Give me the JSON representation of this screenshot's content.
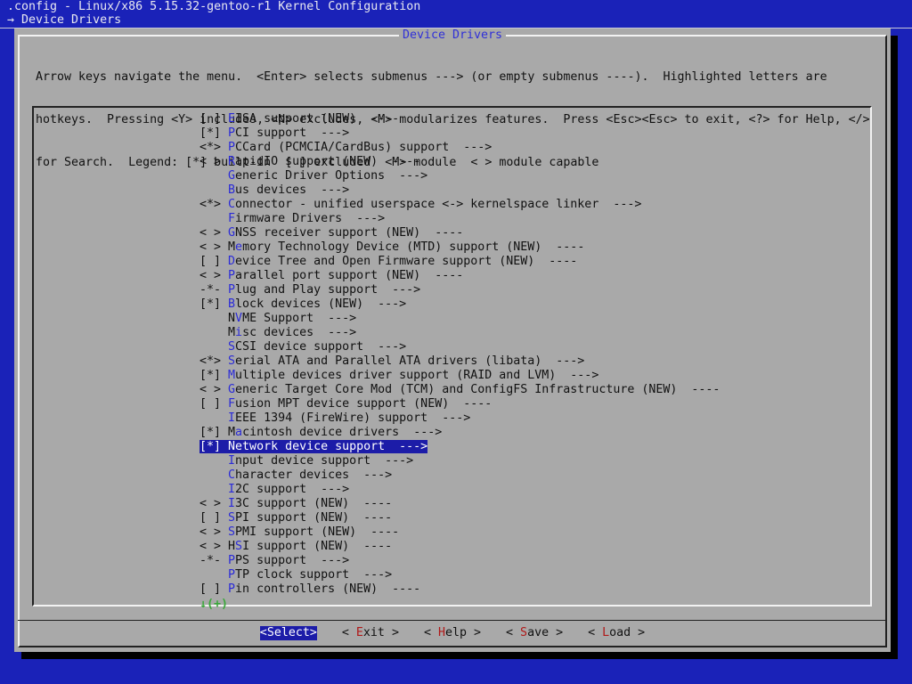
{
  "window": {
    "title": ".config - Linux/x86 5.15.32-gentoo-r1 Kernel Configuration",
    "breadcrumb_arrow": "→",
    "breadcrumb": "Device Drivers"
  },
  "dialog": {
    "title": "Device Drivers",
    "help_lines": [
      "Arrow keys navigate the menu.  <Enter> selects submenus ---> (or empty submenus ----).  Highlighted letters are",
      "hotkeys.  Pressing <Y> includes, <N> excludes, <M> modularizes features.  Press <Esc><Esc> to exit, <?> for Help, </>",
      "for Search.  Legend: [*] built-in  [ ] excluded  <M> module  < > module capable"
    ]
  },
  "menu": {
    "selected_index": 23,
    "items": [
      {
        "prefix": "[ ] ",
        "hotkey": "E",
        "rest": "ISA support (NEW)  ----"
      },
      {
        "prefix": "[*] ",
        "hotkey": "P",
        "rest": "CI support  --->"
      },
      {
        "prefix": "<*> ",
        "hotkey": "P",
        "rest": "CCard (PCMCIA/CardBus) support  --->"
      },
      {
        "prefix": "< > ",
        "hotkey": "R",
        "rest": "apidIO support (NEW)  ----"
      },
      {
        "prefix": "    ",
        "hotkey": "G",
        "rest": "eneric Driver Options  --->"
      },
      {
        "prefix": "    ",
        "hotkey": "B",
        "rest": "us devices  --->"
      },
      {
        "prefix": "<*> ",
        "hotkey": "C",
        "rest": "onnector - unified userspace <-> kernelspace linker  --->"
      },
      {
        "prefix": "    ",
        "hotkey": "F",
        "rest": "irmware Drivers  --->"
      },
      {
        "prefix": "< > ",
        "hotkey": "G",
        "rest": "NSS receiver support (NEW)  ----"
      },
      {
        "prefix": "< > ",
        "pre": "M",
        "hotkey": "e",
        "rest": "mory Technology Device (MTD) support (NEW)  ----"
      },
      {
        "prefix": "[ ] ",
        "hotkey": "D",
        "rest": "evice Tree and Open Firmware support (NEW)  ----"
      },
      {
        "prefix": "< > ",
        "hotkey": "P",
        "rest": "arallel port support (NEW)  ----"
      },
      {
        "prefix": "-*- ",
        "hotkey": "P",
        "rest": "lug and Play support  --->"
      },
      {
        "prefix": "[*] ",
        "hotkey": "B",
        "rest": "lock devices (NEW)  --->"
      },
      {
        "prefix": "    ",
        "pre": "N",
        "hotkey": "V",
        "rest": "ME Support  --->"
      },
      {
        "prefix": "    ",
        "pre": "M",
        "hotkey": "i",
        "rest": "sc devices  --->"
      },
      {
        "prefix": "    ",
        "hotkey": "S",
        "rest": "CSI device support  --->"
      },
      {
        "prefix": "<*> ",
        "hotkey": "S",
        "rest": "erial ATA and Parallel ATA drivers (libata)  --->"
      },
      {
        "prefix": "[*] ",
        "hotkey": "M",
        "rest": "ultiple devices driver support (RAID and LVM)  --->"
      },
      {
        "prefix": "< > ",
        "hotkey": "G",
        "rest": "eneric Target Core Mod (TCM) and ConfigFS Infrastructure (NEW)  ----"
      },
      {
        "prefix": "[ ] ",
        "hotkey": "F",
        "rest": "usion MPT device support (NEW)  ----"
      },
      {
        "prefix": "    ",
        "hotkey": "I",
        "rest": "EEE 1394 (FireWire) support  --->"
      },
      {
        "prefix": "[*] ",
        "pre": "M",
        "hotkey": "a",
        "rest": "cintosh device drivers  --->"
      },
      {
        "prefix": "[*] ",
        "hotkey": "N",
        "rest": "etwork device support  --->"
      },
      {
        "prefix": "    ",
        "hotkey": "I",
        "rest": "nput device support  --->"
      },
      {
        "prefix": "    ",
        "hotkey": "C",
        "rest": "haracter devices  --->"
      },
      {
        "prefix": "    ",
        "hotkey": "I",
        "rest": "2C support  --->"
      },
      {
        "prefix": "< > ",
        "hotkey": "I",
        "rest": "3C support (NEW)  ----"
      },
      {
        "prefix": "[ ] ",
        "hotkey": "S",
        "rest": "PI support (NEW)  ----"
      },
      {
        "prefix": "< > ",
        "hotkey": "S",
        "rest": "PMI support (NEW)  ----"
      },
      {
        "prefix": "< > ",
        "pre": "H",
        "hotkey": "S",
        "rest": "I support (NEW)  ----"
      },
      {
        "prefix": "-*- ",
        "hotkey": "P",
        "rest": "PS support  --->"
      },
      {
        "prefix": "    ",
        "hotkey": "P",
        "rest": "TP clock support  --->"
      },
      {
        "prefix": "[ ] ",
        "hotkey": "P",
        "rest": "in controllers (NEW)  ----"
      }
    ],
    "scroll_indicator": "↓(+)"
  },
  "buttons": [
    {
      "name": "select-button",
      "open": "<",
      "hotkey": "S",
      "rest": "elect",
      "close": ">",
      "active": true
    },
    {
      "name": "exit-button",
      "open": "< ",
      "hotkey": "E",
      "rest": "xit",
      "close": " >",
      "active": false
    },
    {
      "name": "help-button",
      "open": "< ",
      "hotkey": "H",
      "rest": "elp",
      "close": " >",
      "active": false
    },
    {
      "name": "save-button",
      "open": "< ",
      "hotkey": "S",
      "rest": "ave",
      "close": " >",
      "active": false
    },
    {
      "name": "load-button",
      "open": "< ",
      "hotkey": "L",
      "rest": "oad",
      "close": " >",
      "active": false
    }
  ],
  "colors": {
    "background": "#1a22b8",
    "dialog": "#a9a9a9",
    "hotkey": "#2a2ad8",
    "selection": "#1c1ca8",
    "button_hotkey": "#b01818",
    "scroll_indicator": "#3aa83a"
  }
}
